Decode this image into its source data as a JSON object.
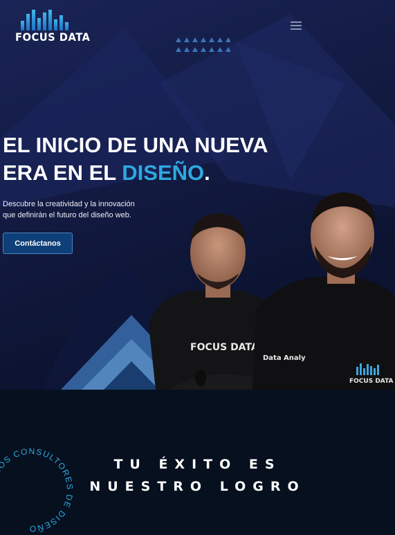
{
  "brand": {
    "name": "FOCUS DATA"
  },
  "header": {
    "menu_icon": "hamburger-menu-icon"
  },
  "hero": {
    "headline_part1": "EL INICIO DE UNA NUEVA",
    "headline_part2": "ERA EN EL",
    "headline_accent": "DISEÑO",
    "headline_end": ".",
    "subtext_line1": "Descubre la creatividad y la innovación",
    "subtext_line2": "que definirán el futuro del diseño web.",
    "cta_label": "Contáctanos",
    "shirt_left": "FOCUS DATA",
    "shirt_right_top": "Data Analy",
    "shirt_right_logo": "FOCUS DATA"
  },
  "section2": {
    "title_line1": "TU ÉXITO ES",
    "title_line2": "NUESTRO LOGRO",
    "circle_text": "SOMOS CONSULTORES DE DISEÑO"
  },
  "colors": {
    "accent": "#2ea8e0",
    "hero_bg": "#141c45",
    "cta_bg": "#0f3f78",
    "dark_bg": "#06101f"
  }
}
